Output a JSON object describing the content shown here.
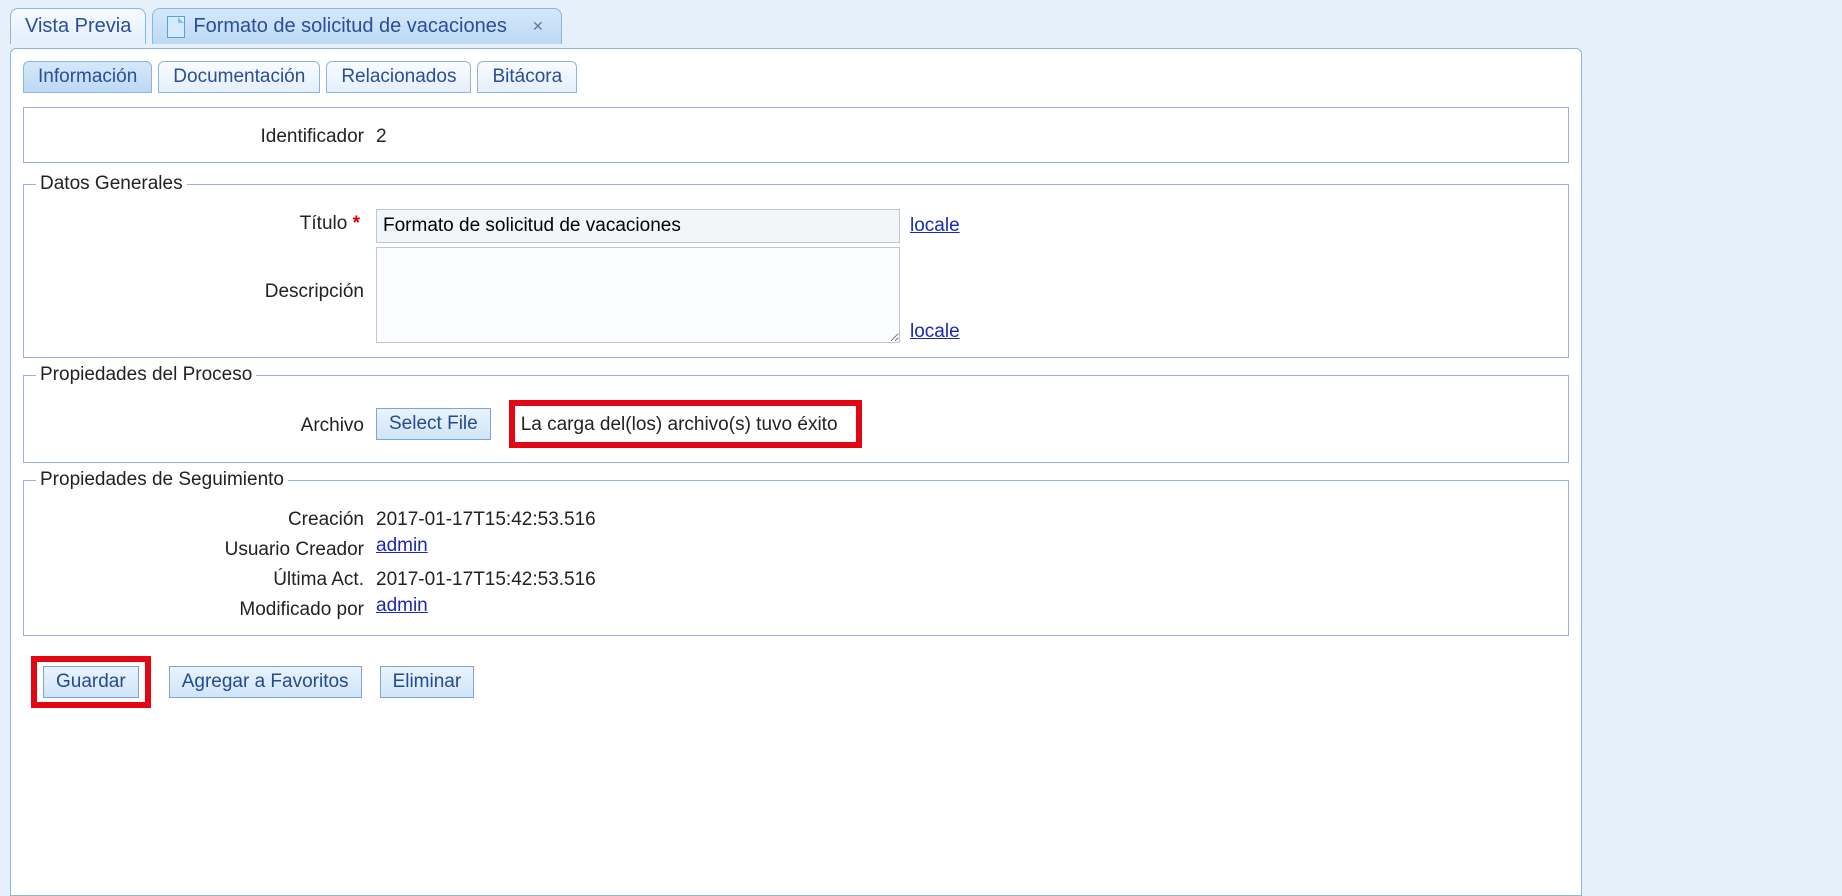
{
  "outer_tabs": {
    "preview_label": "Vista Previa",
    "doc_label": "Formato de solicitud de vacaciones"
  },
  "inner_tabs": {
    "info": "Información",
    "docs": "Documentación",
    "related": "Relacionados",
    "log": "Bitácora"
  },
  "identifier": {
    "label": "Identificador",
    "value": "2"
  },
  "general": {
    "legend": "Datos Generales",
    "title_label": "Título",
    "title_value": "Formato de solicitud de vacaciones",
    "desc_label": "Descripción",
    "desc_value": "",
    "locale_link": "locale"
  },
  "process": {
    "legend": "Propiedades del Proceso",
    "file_label": "Archivo",
    "select_file_btn": "Select File",
    "upload_status": "La carga del(los) archivo(s) tuvo éxito"
  },
  "tracking": {
    "legend": "Propiedades de Seguimiento",
    "created_label": "Creación",
    "created_value": "2017-01-17T15:42:53.516",
    "creator_label": "Usuario Creador",
    "creator_value": "admin",
    "updated_label": "Última Act.",
    "updated_value": "2017-01-17T15:42:53.516",
    "modby_label": "Modificado por",
    "modby_value": "admin"
  },
  "actions": {
    "save": "Guardar",
    "fav": "Agregar a Favoritos",
    "delete": "Eliminar"
  }
}
